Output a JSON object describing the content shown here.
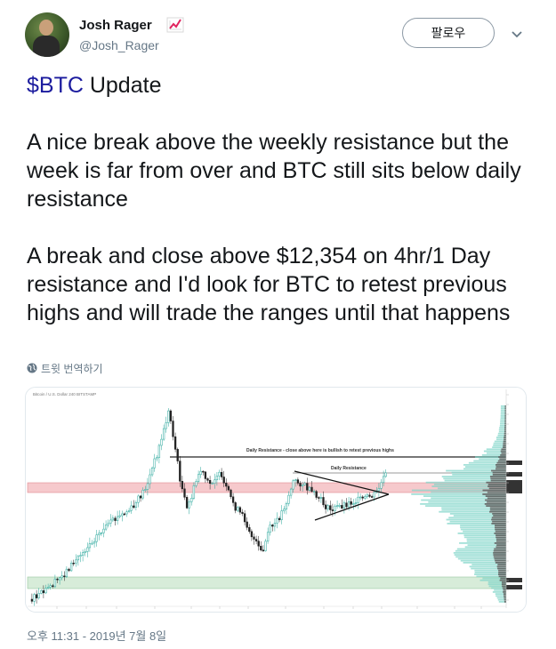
{
  "user": {
    "name": "Josh Rager",
    "handle": "@Josh_Rager",
    "badge_icon": "chart-increasing-icon",
    "follow_label": "팔로우"
  },
  "tweet": {
    "cashtag": "$BTC",
    "line1_rest": " Update",
    "para1": "A nice break above the weekly resistance but the week is far from over and BTC still sits below daily resistance",
    "para2": "A break and close above $12,354 on 4hr/1 Day resistance and I'd look for BTC to retest previous highs and will trade the ranges until that happens",
    "translate_label": "트윗 번역하기",
    "timestamp": "오후 11:31 - 2019년 7월 8일"
  },
  "chart": {
    "header": "Bitcoin / U.S. Dollar  240  BITSTAMP",
    "annotation_daily_long": "Daily Resistance - close above here is bullish to retest previous highs",
    "annotation_daily": "Daily Resistance",
    "colors": {
      "up": "#26a69a",
      "down": "#222222",
      "resistance_zone": "#f6c9cc",
      "support_zone": "#d7ecd9",
      "volume_profile": "#7ed4c8",
      "volume_dark": "#5a5a5a",
      "price_label": "#333333"
    }
  }
}
